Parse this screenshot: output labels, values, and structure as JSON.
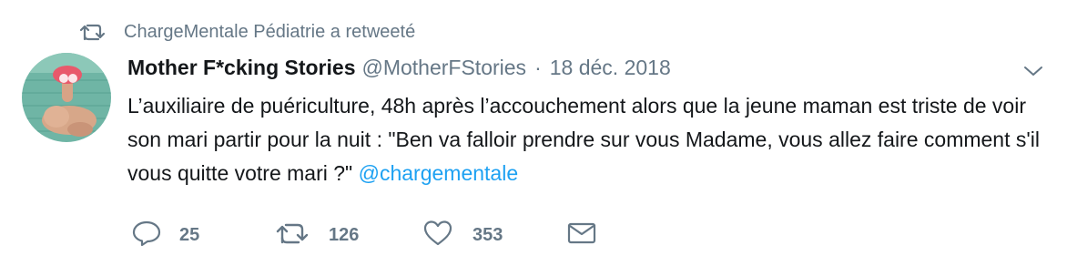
{
  "retweet_context": {
    "text": "ChargeMentale Pédiatrie a retweeté",
    "icon": "retweet-icon"
  },
  "author": {
    "display_name": "Mother F*cking Stories",
    "screen_name": "@MotherFStories",
    "avatar_icon": "avatar-photo"
  },
  "meta": {
    "separator": "·",
    "timestamp": "18 déc. 2018"
  },
  "tweet": {
    "text": "L’auxiliaire de puériculture, 48h après l’accouchement alors que la jeune maman est triste de voir son mari partir pour la nuit : \"Ben va falloir prendre sur vous Madame, vous allez faire comment s'il vous quitte votre mari ?\" ",
    "mention": "@chargementale"
  },
  "actions": {
    "reply": {
      "icon": "reply-icon",
      "count": "25"
    },
    "retweet": {
      "icon": "retweet-icon",
      "count": "126"
    },
    "like": {
      "icon": "heart-icon",
      "count": "353"
    },
    "dm": {
      "icon": "envelope-icon"
    }
  },
  "colors": {
    "text": "#14171a",
    "secondary": "#657786",
    "link": "#1da1f2"
  }
}
